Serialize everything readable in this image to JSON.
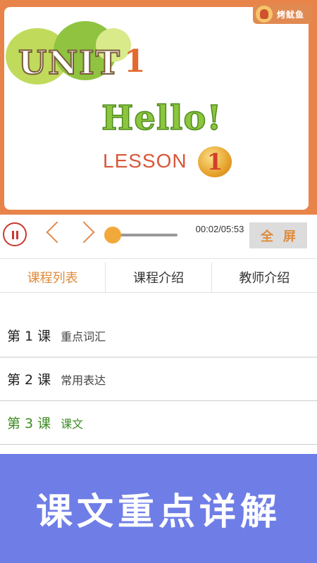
{
  "video": {
    "brand": "烤鱿鱼",
    "unit_word": "UNIT",
    "unit_number": "1",
    "hello": "Hello!",
    "lesson_word": "LESSON",
    "lesson_number": "1"
  },
  "player": {
    "time": "00:02/05:53",
    "fullscreen_label": "全屏",
    "progress": 0.006
  },
  "tabs": [
    {
      "label": "课程列表",
      "active": true
    },
    {
      "label": "课程介绍",
      "active": false
    },
    {
      "label": "教师介绍",
      "active": false
    }
  ],
  "lessons": [
    {
      "num": "第 1 课",
      "title": "重点词汇"
    },
    {
      "num": "第 2 课",
      "title": "常用表达"
    },
    {
      "num": "第 3 课",
      "title": "课文"
    }
  ],
  "banner": {
    "text": "课文重点详解"
  },
  "colors": {
    "accent": "#e08a3a",
    "current_lesson": "#3c8c22",
    "banner_bg": "#6f7ee6"
  }
}
